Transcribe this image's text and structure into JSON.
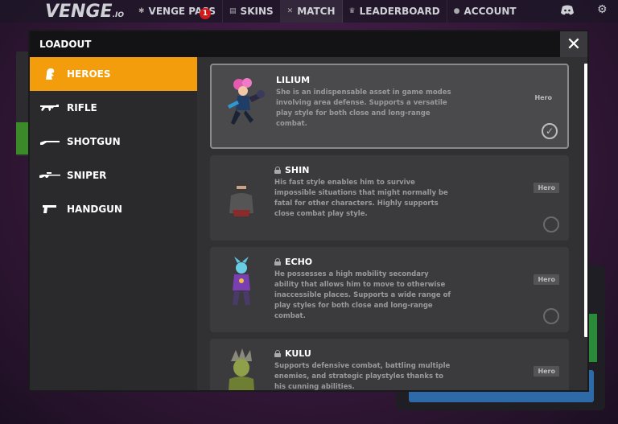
{
  "topbar": {
    "logo": "VENGE",
    "logo_suffix": ".IO",
    "nav": [
      {
        "label": "VENGE PASS",
        "icon": "pass-icon"
      },
      {
        "label": "SKINS",
        "icon": "skins-icon"
      },
      {
        "label": "MATCH",
        "icon": "swords-icon"
      },
      {
        "label": "LEADERBOARD",
        "icon": "crown-icon"
      },
      {
        "label": "ACCOUNT",
        "icon": "user-icon"
      }
    ],
    "pass_badge": "1"
  },
  "modal": {
    "title": "LOADOUT",
    "close_label": "✕"
  },
  "sidebar": {
    "items": [
      {
        "label": "HEROES",
        "icon": "hero-icon",
        "active": true
      },
      {
        "label": "RIFLE",
        "icon": "rifle-icon"
      },
      {
        "label": "SHOTGUN",
        "icon": "shotgun-icon"
      },
      {
        "label": "SNIPER",
        "icon": "sniper-icon"
      },
      {
        "label": "HANDGUN",
        "icon": "handgun-icon"
      }
    ]
  },
  "heroes": [
    {
      "name": "LILIUM",
      "locked": false,
      "selected": true,
      "tag": "Hero",
      "desc": "She is an indispensable asset in game modes involving area defense. Supports a versatile play style for both close and long-range combat."
    },
    {
      "name": "SHIN",
      "locked": true,
      "selected": false,
      "tag": "Hero",
      "desc": "His fast style enables him to survive impossible situations that might normally be fatal for other characters. Highly supports close combat play style."
    },
    {
      "name": "ECHO",
      "locked": true,
      "selected": false,
      "tag": "Hero",
      "desc": "He possesses a high mobility secondary ability that allows him to move to otherwise inaccessible places. Supports a wide range of play styles for both close and long-range combat."
    },
    {
      "name": "KULU",
      "locked": true,
      "selected": false,
      "tag": "Hero",
      "desc": "Supports defensive combat, battling multiple enemies, and strategic playstyles thanks to his cunning abilities."
    }
  ],
  "colors": {
    "accent": "#f39c0c",
    "badge": "#d11a1a"
  }
}
